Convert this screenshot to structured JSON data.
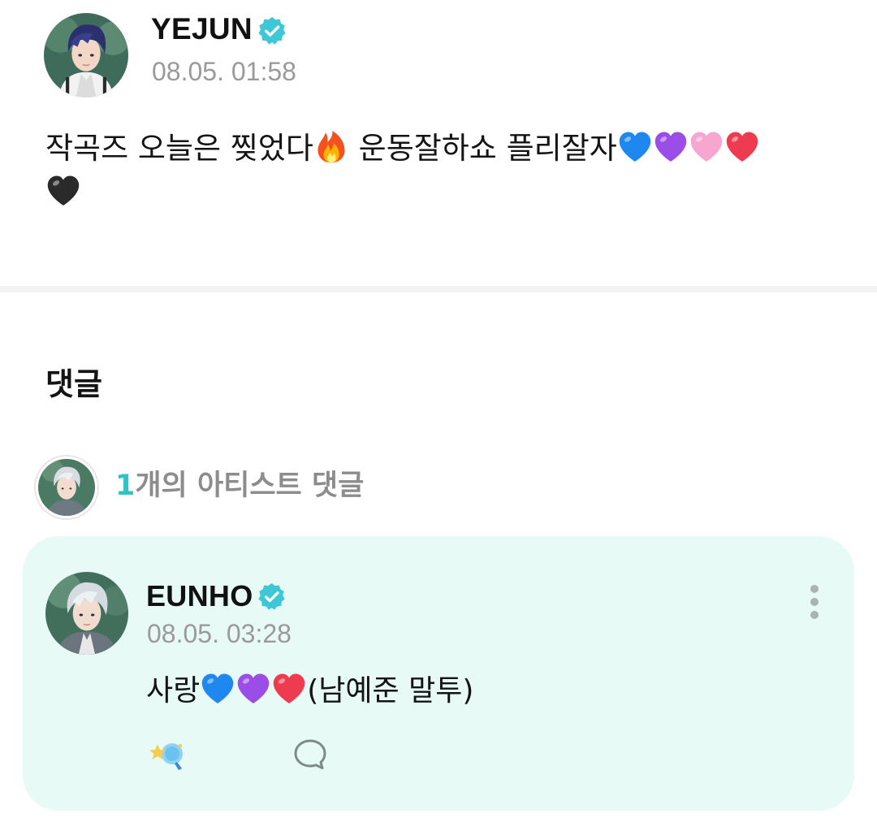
{
  "post": {
    "author": "YEJUN",
    "verified_icon": "verified-badge-icon",
    "timestamp": "08.05. 01:58",
    "body_part1": "작곡즈 오늘은 찢었다",
    "body_part2": " 운동잘하쇼 플리잘자",
    "body_emojis": [
      "fire-emoji",
      "blue-heart-emoji",
      "purple-heart-emoji",
      "pink-heart-emoji",
      "red-heart-emoji",
      "black-heart-emoji"
    ]
  },
  "comments": {
    "title": "댓글",
    "artist_summary": {
      "count": "1",
      "label": "개의 아티스트 댓글"
    },
    "items": [
      {
        "author": "EUNHO",
        "timestamp": "08.05. 03:28",
        "body_prefix": "사랑",
        "body_suffix": "(남예준 말투)",
        "body_emojis": [
          "blue-heart-emoji",
          "purple-heart-emoji",
          "red-heart-emoji"
        ],
        "actions": [
          "reaction-icon",
          "reply-bubble-icon",
          "more-vertical-icon"
        ]
      }
    ]
  },
  "colors": {
    "accent": "#2fc3c3",
    "verified": "#3ec7d6",
    "card_background": "#e8faf6",
    "timestamp": "#9a9a9a"
  }
}
